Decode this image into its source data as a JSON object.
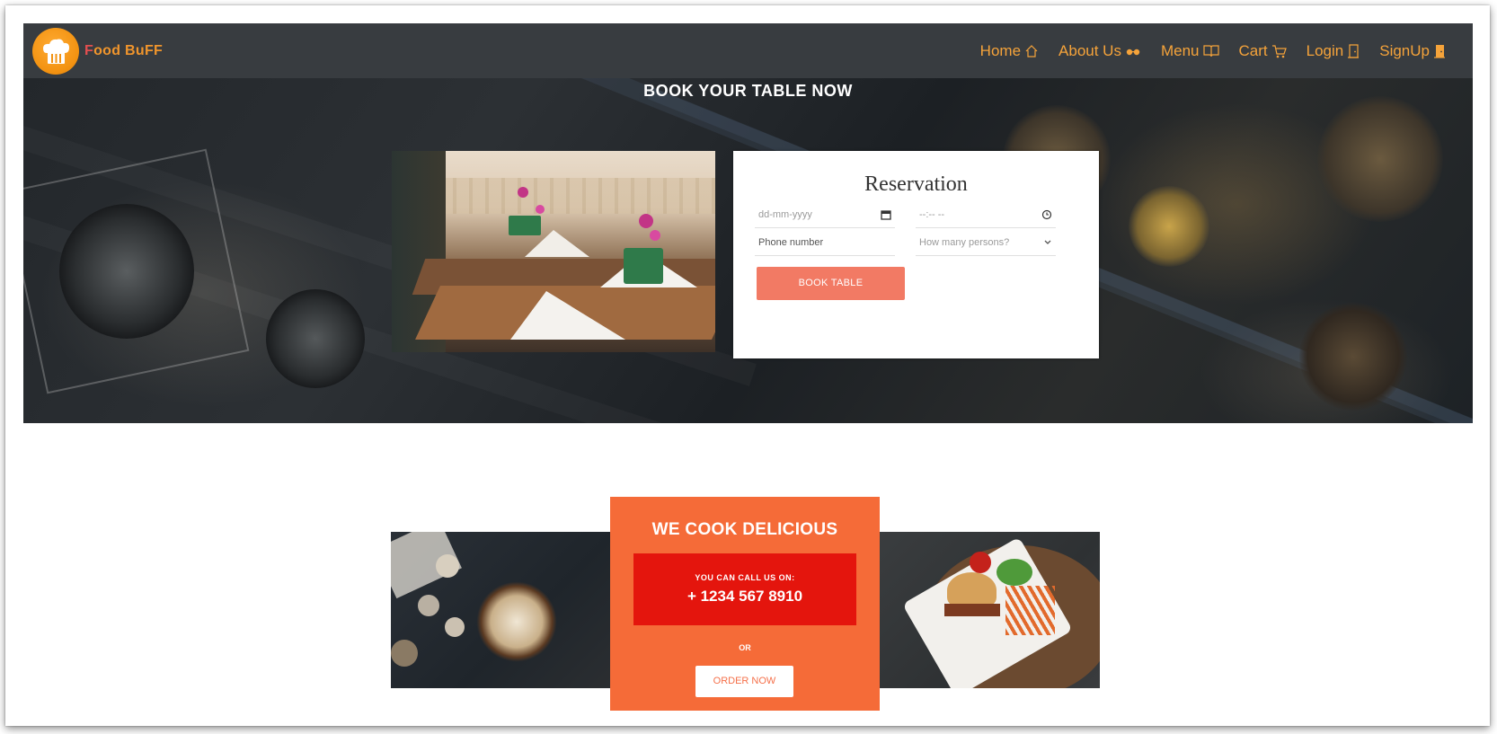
{
  "brand": {
    "name_first_letter": "F",
    "name_rest": "ood BuFF",
    "logo_icon": "chef-hat-utensils-icon"
  },
  "nav": {
    "items": [
      {
        "label": "Home",
        "icon": "home-icon"
      },
      {
        "label": "About Us",
        "icon": "glasses-icon"
      },
      {
        "label": "Menu",
        "icon": "book-open-icon"
      },
      {
        "label": "Cart",
        "icon": "cart-icon"
      },
      {
        "label": "Login",
        "icon": "login-door-icon"
      },
      {
        "label": "SignUp",
        "icon": "signup-door-icon"
      }
    ]
  },
  "hero": {
    "title": "BOOK YOUR TABLE NOW"
  },
  "reservation": {
    "title": "Reservation",
    "date_placeholder": "dd-mm-yyyy",
    "time_placeholder": "--:-- --",
    "phone_placeholder": "Phone number",
    "persons_placeholder": "How many persons?",
    "submit_label": "BOOK TABLE"
  },
  "promo": {
    "title": "WE COOK DELICIOUS",
    "call_label": "YOU CAN CALL US ON:",
    "phone": "+ 1234 567 8910",
    "or_text": "OR",
    "order_label": "ORDER NOW"
  },
  "colors": {
    "nav_bg": "#383c40",
    "nav_text": "#f5a33a",
    "brand_orange": "#f39312",
    "book_button": "#f27a64",
    "promo_orange": "#f56b38",
    "call_red": "#e4150d"
  }
}
